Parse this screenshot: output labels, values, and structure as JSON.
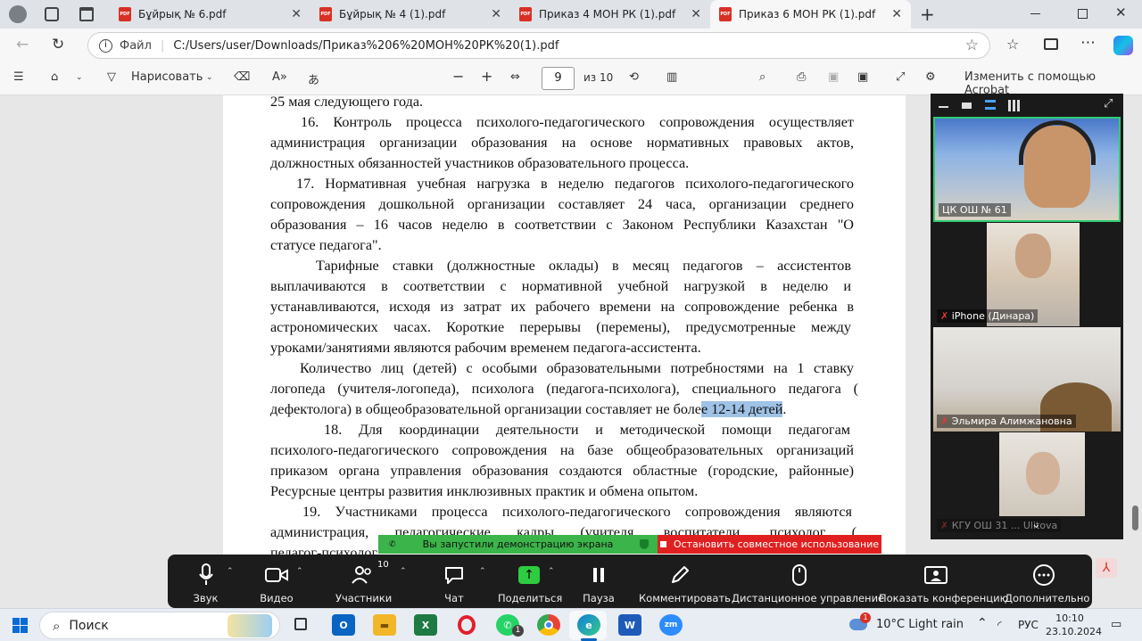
{
  "browser": {
    "tabs": [
      {
        "title": "Бұйрық № 6.pdf",
        "active": false
      },
      {
        "title": "Бұйрық № 4 (1).pdf",
        "active": false
      },
      {
        "title": "Приказ 4 МОН РК (1).pdf",
        "active": false
      },
      {
        "title": "Приказ 6 МОН РК (1).pdf",
        "active": true
      }
    ],
    "icons": {
      "new_tab": "plus-icon",
      "close": "close-icon",
      "minimize": "minimize-icon",
      "restore": "restore-icon"
    },
    "address": {
      "label": "Файл",
      "url": "C:/Users/user/Downloads/Приказ%206%20МОН%20РК%20(1).pdf"
    }
  },
  "pdf_toolbar": {
    "draw_label": "Нарисовать",
    "page_input": "9",
    "page_total": "из 10",
    "edit_acrobat": "Изменить с помощью Acrobat"
  },
  "document": {
    "lines": [
      {
        "text": "25 мая следующего года."
      },
      {
        "text": "16. Контроль процесса психолого-педагогического сопровождения осуществляет"
      },
      {
        "text": "администрация организации образования на основе нормативных правовых актов,"
      },
      {
        "text": "должностных обязанностей участников образовательного процесса."
      },
      {
        "text": "17. Нормативная учебная нагрузка в неделю педагогов психолого-педагогического"
      },
      {
        "text": "сопровождения дошкольной организации составляет 24 часа, организации среднего"
      },
      {
        "text": "образования – 16 часов неделю в соответствии с Законом Республики Казахстан \"О"
      },
      {
        "text": "статусе педагога\"."
      },
      {
        "text": "Тарифные ставки (должностные оклады) в месяц педагогов – ассистентов"
      },
      {
        "text": "выплачиваются в соответствии с нормативной учебной нагрузкой в неделю и"
      },
      {
        "text": "устанавливаются, исходя из затрат их рабочего времени на сопровождение ребенка в"
      },
      {
        "text": "астрономических часах. Короткие перерывы (перемены), предусмотренные между"
      },
      {
        "text": "уроками/занятиями являются рабочим временем педагога-ассистента."
      },
      {
        "text": "Количество лиц (детей) с особыми образовательными потребностями на 1 ставку"
      },
      {
        "text": "логопеда (учителя-логопеда), психолога (педагога-психолога), специального педагога ("
      },
      {
        "text": "дефектолога) в общеобразовательной организации составляет не боле",
        "highlight": "е 12-14 детей",
        "after": "."
      },
      {
        "text": "18. Для координации деятельности и методической помощи педагогам"
      },
      {
        "text": "психолого-педагогического сопровождения на базе общеобразовательных организаций"
      },
      {
        "text": "приказом органа управления образования создаются областные (городские, районные)"
      },
      {
        "text": "Ресурсные центры развития инклюзивных практик и обмена опытом."
      },
      {
        "text": "19. Участниками процесса психолого-педагогического сопровождения являются"
      },
      {
        "text": "администрация, педагогические кадры (учителя, воспитатели, психолог ("
      },
      {
        "text": "педагог-психолог"
      }
    ]
  },
  "zoom": {
    "participants": [
      {
        "name": "ЦК ОШ № 61",
        "muted": false,
        "active_speaker": true
      },
      {
        "name": "iPhone (Динара)",
        "muted": true
      },
      {
        "name": "Эльмира Алимжановна",
        "muted": true
      },
      {
        "name": "КГУ ОШ 31 ... Ulitova",
        "muted": true
      }
    ],
    "share_banner": {
      "status": "Вы запустили демонстрацию экрана",
      "stop": "Остановить совместное использование"
    },
    "controls": {
      "audio": "Звук",
      "video": "Видео",
      "participants": "Участники",
      "participants_count": "10",
      "chat": "Чат",
      "share": "Поделиться",
      "pause": "Пауза",
      "annotate": "Комментировать",
      "remote": "Дистанционное управление",
      "show_conf": "Показать конференцию",
      "more": "Дополнительно"
    }
  },
  "taskbar": {
    "search": "Поиск",
    "weather": "10°C  Light rain",
    "weather_badge": "1",
    "lang": "РУС",
    "time": "10:10",
    "date": "23.10.2024",
    "whatsapp_badge": "1",
    "apps": [
      "Outlook",
      "Проводник",
      "Excel",
      "Opera",
      "WhatsApp",
      "Chrome",
      "Edge",
      "Word",
      "Zoom"
    ]
  },
  "colors": {
    "highlight": "#9fc3e6",
    "zoom_green": "#3bb44a",
    "zoom_red": "#e02020",
    "speaker_border": "#2ecc71"
  }
}
